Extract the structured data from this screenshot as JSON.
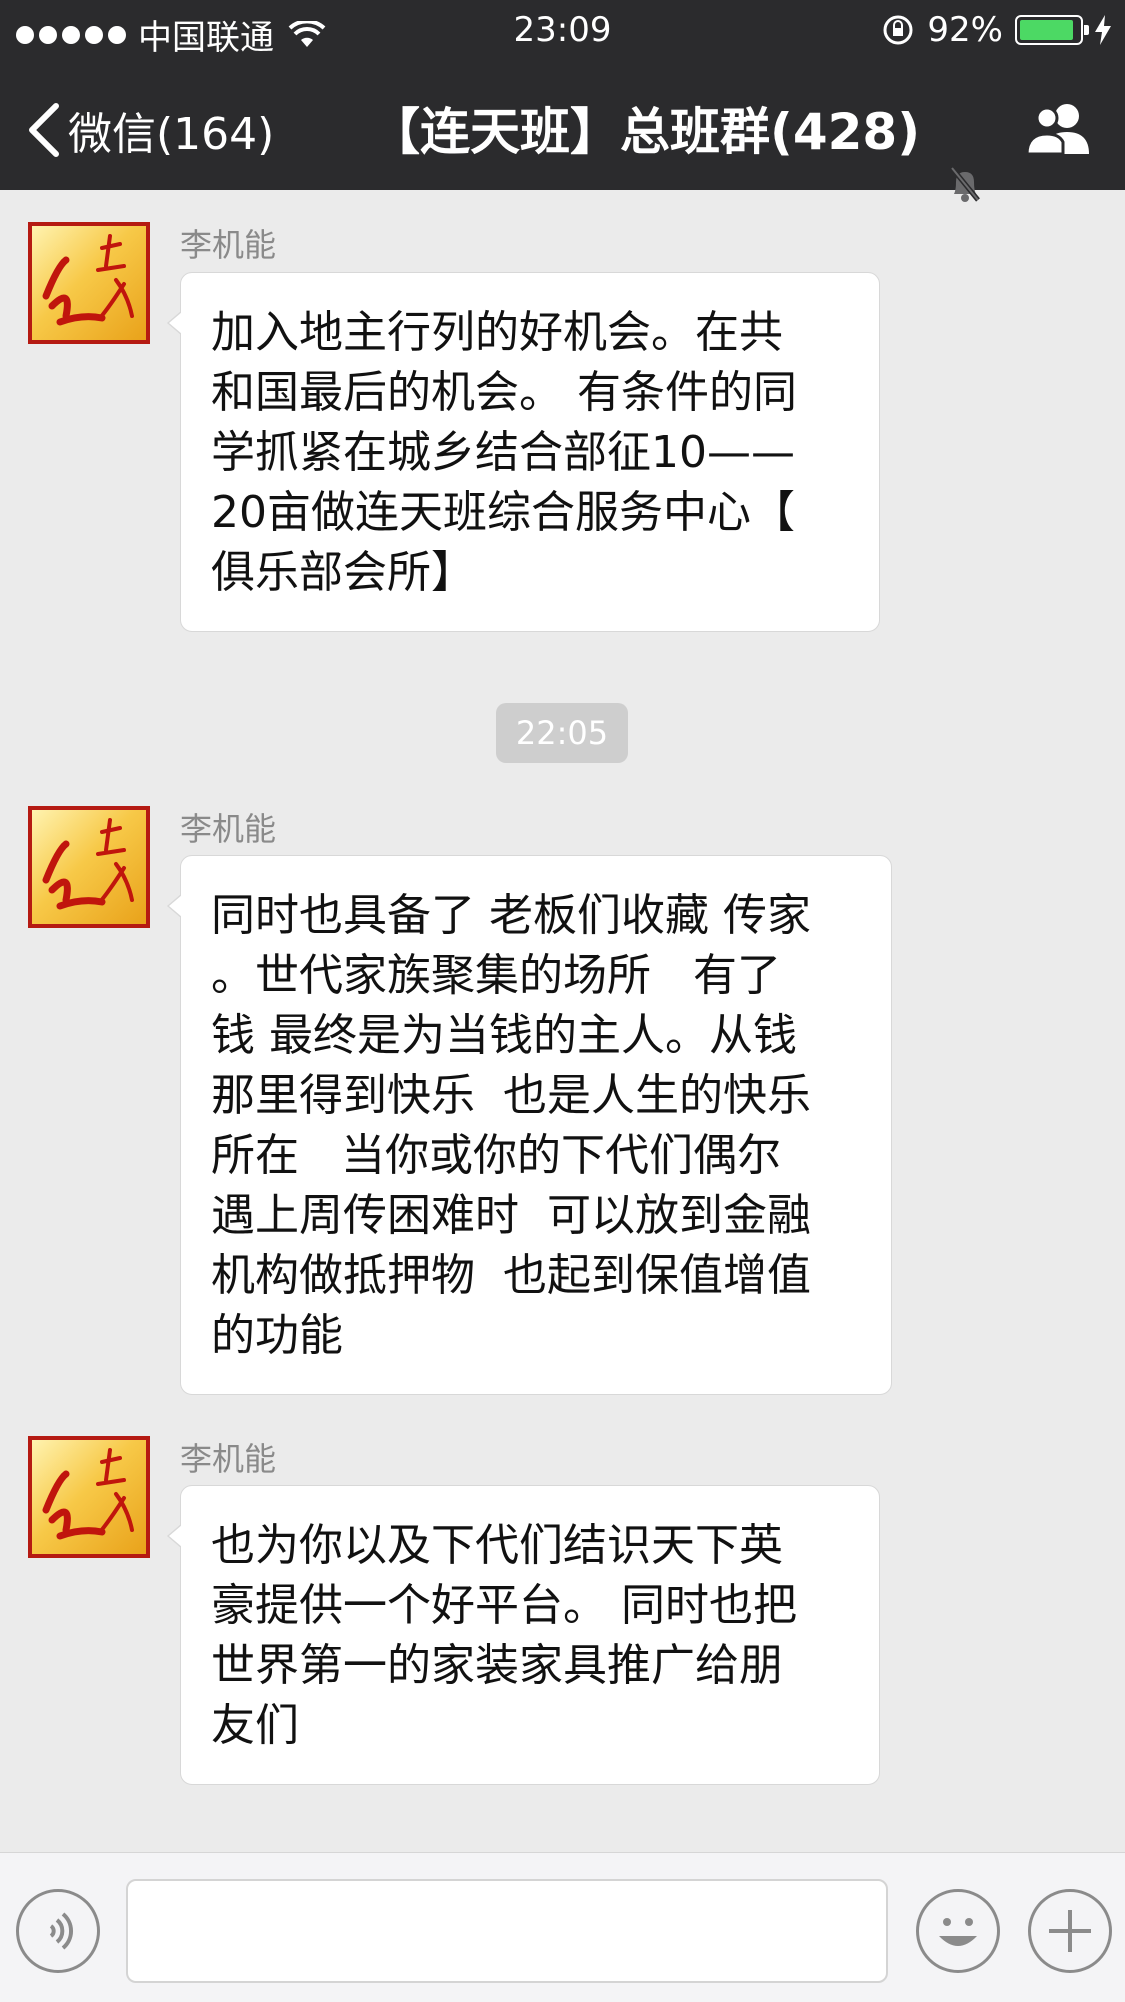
{
  "status": {
    "carrier": "中国联通",
    "time": "23:09",
    "battery": "92%",
    "battery_level": 0.92
  },
  "nav": {
    "back_label": "微信(164)",
    "title": "【连天班】总班群(428)"
  },
  "messages": [
    {
      "sender": "李机能",
      "lines": [
        "加入地主行列的好机会。在共",
        "和国最后的机会。 有条件的同",
        "学抓紧在城乡结合部征10——",
        "20亩做连天班综合服务中心【",
        "俱乐部会所】"
      ]
    },
    {
      "sender": "李机能",
      "lines": [
        "同时也具备了 老板们收藏 传家",
        "。世代家族聚集的场所   有了",
        "钱 最终是为当钱的主人。从钱",
        "那里得到快乐  也是人生的快乐",
        "所在   当你或你的下代们偶尔",
        "遇上周传困难时  可以放到金融",
        "机构做抵押物  也起到保值增值",
        "的功能"
      ]
    },
    {
      "sender": "李机能",
      "lines": [
        "也为你以及下代们结识天下英",
        "豪提供一个好平台。 同时也把",
        "世界第一的家装家具推广给朋",
        "友们"
      ]
    }
  ],
  "timestamp": "22:05",
  "icons": {
    "back": "chevron-left-icon",
    "mute": "bell-slash-icon",
    "group": "group-members-icon",
    "voice": "voice-icon",
    "emoji": "emoji-icon",
    "plus": "plus-icon"
  },
  "colors": {
    "nav_bg": "#2b2b2d",
    "chat_bg": "#ebebeb",
    "battery": "#4cd964"
  }
}
